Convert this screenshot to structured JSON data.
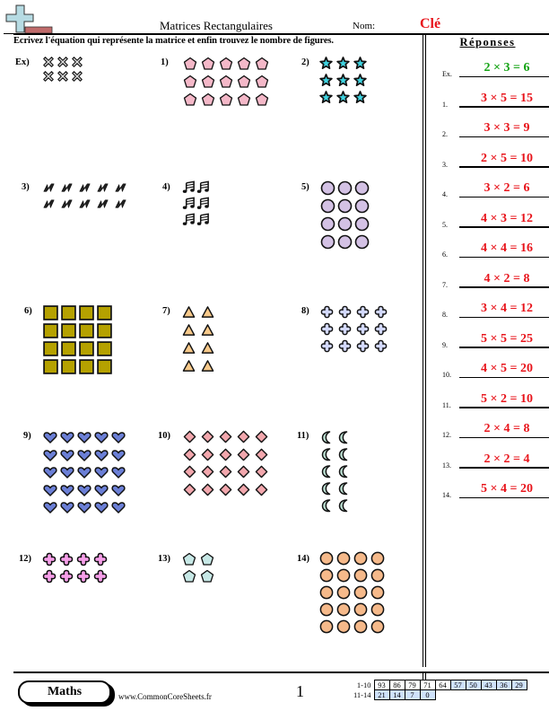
{
  "header": {
    "title": "Matrices Rectangulaires",
    "name_label": "Nom:",
    "name_value": "Clé",
    "logo_icon": "plus-ruler-logo-icon",
    "instructions": "Ecrivez l'équation qui représente la matrice et enfin trouvez le nombre de figures."
  },
  "answers": {
    "title": "Réponses",
    "items": [
      {
        "num": "Ex.",
        "text": "2 × 3 = 6",
        "example": true
      },
      {
        "num": "1.",
        "text": "3 × 5 = 15"
      },
      {
        "num": "2.",
        "text": "3 × 3 = 9"
      },
      {
        "num": "3.",
        "text": "2 × 5 = 10"
      },
      {
        "num": "4.",
        "text": "3 × 2 = 6"
      },
      {
        "num": "5.",
        "text": "4 × 3 = 12"
      },
      {
        "num": "6.",
        "text": "4 × 4 = 16"
      },
      {
        "num": "7.",
        "text": "4 × 2 = 8"
      },
      {
        "num": "8.",
        "text": "3 × 4 = 12"
      },
      {
        "num": "9.",
        "text": "5 × 5 = 25"
      },
      {
        "num": "10.",
        "text": "4 × 5 = 20"
      },
      {
        "num": "11.",
        "text": "5 × 2 = 10"
      },
      {
        "num": "12.",
        "text": "2 × 4 = 8"
      },
      {
        "num": "13.",
        "text": "2 × 2 = 4"
      },
      {
        "num": "14.",
        "text": "5 × 4 = 20"
      }
    ],
    "colors": {
      "answer": "#e8141b",
      "example": "#13a313"
    }
  },
  "problems": [
    {
      "label": "Ex)",
      "shape": "x-mark",
      "rows": 2,
      "cols": 3,
      "fill": "#d9d9d9"
    },
    {
      "label": "1)",
      "shape": "pentagon",
      "rows": 3,
      "cols": 5,
      "fill": "#f4b8c8"
    },
    {
      "label": "2)",
      "shape": "star",
      "rows": 3,
      "cols": 3,
      "fill": "#3fd3e0"
    },
    {
      "label": "3)",
      "shape": "lightning",
      "rows": 2,
      "cols": 5,
      "fill": "#222222"
    },
    {
      "label": "4)",
      "shape": "music-note",
      "rows": 3,
      "cols": 2,
      "fill": "#222222"
    },
    {
      "label": "5)",
      "shape": "circle",
      "rows": 4,
      "cols": 3,
      "fill": "#d3c1e4"
    },
    {
      "label": "6)",
      "shape": "square",
      "rows": 4,
      "cols": 4,
      "fill": "#b5a100"
    },
    {
      "label": "7)",
      "shape": "triangle",
      "rows": 4,
      "cols": 2,
      "fill": "#f7c98a"
    },
    {
      "label": "8)",
      "shape": "quatrefoil",
      "rows": 3,
      "cols": 4,
      "fill": "#d2d8fa"
    },
    {
      "label": "9)",
      "shape": "heart",
      "rows": 5,
      "cols": 5,
      "fill": "#6b7fd6"
    },
    {
      "label": "10)",
      "shape": "diamond",
      "rows": 4,
      "cols": 5,
      "fill": "#f2a7ad"
    },
    {
      "label": "11)",
      "shape": "crescent",
      "rows": 5,
      "cols": 2,
      "fill": "#bfe3d5"
    },
    {
      "label": "12)",
      "shape": "quatrefoil",
      "rows": 2,
      "cols": 4,
      "fill": "#f59ee8"
    },
    {
      "label": "13)",
      "shape": "pentagon",
      "rows": 2,
      "cols": 2,
      "fill": "#c7e8e6"
    },
    {
      "label": "14)",
      "shape": "circle",
      "rows": 5,
      "cols": 4,
      "fill": "#f5b98a"
    }
  ],
  "footer": {
    "subject": "Maths",
    "website": "www.CommonCoreSheets.fr",
    "page": "1",
    "score_rows": [
      {
        "label": "1-10",
        "values": [
          "93",
          "86",
          "79",
          "71",
          "64",
          "57",
          "50",
          "43",
          "36",
          "29"
        ]
      },
      {
        "label": "11-14",
        "values": [
          "21",
          "14",
          "7",
          "0"
        ]
      }
    ]
  }
}
